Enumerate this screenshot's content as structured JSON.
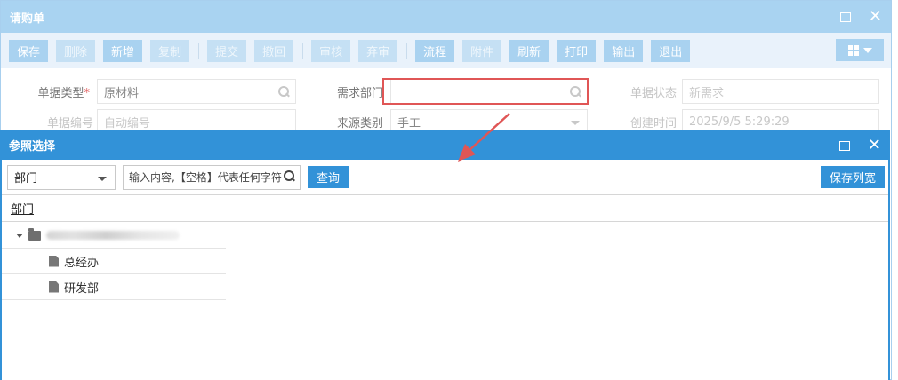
{
  "window": {
    "title": "请购单"
  },
  "toolbar": {
    "buttons": [
      {
        "label": "保存",
        "enabled": true
      },
      {
        "label": "删除",
        "enabled": false
      },
      {
        "label": "新增",
        "enabled": true
      },
      {
        "label": "复制",
        "enabled": false
      },
      {
        "label": "提交",
        "enabled": false
      },
      {
        "label": "撤回",
        "enabled": false
      },
      {
        "label": "审核",
        "enabled": false
      },
      {
        "label": "弃审",
        "enabled": false
      },
      {
        "label": "流程",
        "enabled": true
      },
      {
        "label": "附件",
        "enabled": false
      },
      {
        "label": "刷新",
        "enabled": true
      },
      {
        "label": "打印",
        "enabled": true
      },
      {
        "label": "输出",
        "enabled": true
      },
      {
        "label": "退出",
        "enabled": true
      }
    ]
  },
  "form": {
    "doc_type_label": "单据类型",
    "doc_type_required": "*",
    "doc_type_value": "原材料",
    "dept_label": "需求部门",
    "dept_value": "",
    "status_label": "单据状态",
    "status_value": "新需求",
    "doc_no_label": "单据编号",
    "doc_no_value": "自动编号",
    "source_label": "来源类别",
    "source_value": "手工",
    "created_label": "创建时间",
    "created_value": "2025/9/5 5:29:29"
  },
  "dialog": {
    "title": "参照选择",
    "field_select": "部门",
    "search_placeholder": "输入内容,【空格】代表任何字符",
    "query_label": "查询",
    "save_cols_label": "保存列宽",
    "column_header": "部门",
    "tree": {
      "children": [
        "总经办",
        "研发部"
      ]
    }
  },
  "colors": {
    "title_bar_light": "#a9d3f1",
    "dialog_accent": "#3292d8",
    "highlight": "#e05656"
  }
}
